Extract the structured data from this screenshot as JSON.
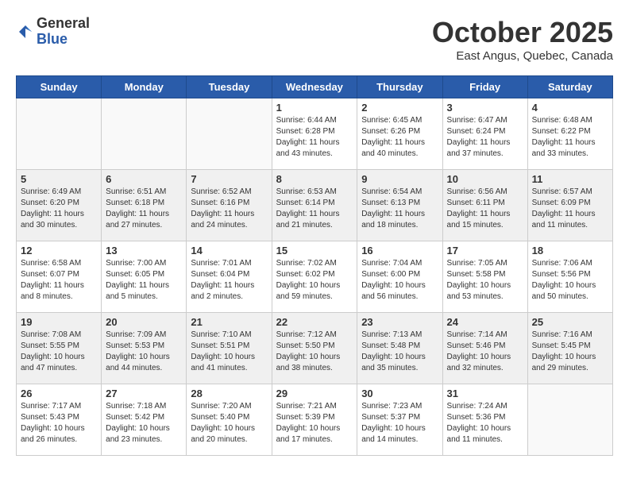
{
  "logo": {
    "general": "General",
    "blue": "Blue"
  },
  "title": "October 2025",
  "location": "East Angus, Quebec, Canada",
  "days_of_week": [
    "Sunday",
    "Monday",
    "Tuesday",
    "Wednesday",
    "Thursday",
    "Friday",
    "Saturday"
  ],
  "weeks": [
    [
      {
        "day": "",
        "info": ""
      },
      {
        "day": "",
        "info": ""
      },
      {
        "day": "",
        "info": ""
      },
      {
        "day": "1",
        "info": "Sunrise: 6:44 AM\nSunset: 6:28 PM\nDaylight: 11 hours\nand 43 minutes."
      },
      {
        "day": "2",
        "info": "Sunrise: 6:45 AM\nSunset: 6:26 PM\nDaylight: 11 hours\nand 40 minutes."
      },
      {
        "day": "3",
        "info": "Sunrise: 6:47 AM\nSunset: 6:24 PM\nDaylight: 11 hours\nand 37 minutes."
      },
      {
        "day": "4",
        "info": "Sunrise: 6:48 AM\nSunset: 6:22 PM\nDaylight: 11 hours\nand 33 minutes."
      }
    ],
    [
      {
        "day": "5",
        "info": "Sunrise: 6:49 AM\nSunset: 6:20 PM\nDaylight: 11 hours\nand 30 minutes."
      },
      {
        "day": "6",
        "info": "Sunrise: 6:51 AM\nSunset: 6:18 PM\nDaylight: 11 hours\nand 27 minutes."
      },
      {
        "day": "7",
        "info": "Sunrise: 6:52 AM\nSunset: 6:16 PM\nDaylight: 11 hours\nand 24 minutes."
      },
      {
        "day": "8",
        "info": "Sunrise: 6:53 AM\nSunset: 6:14 PM\nDaylight: 11 hours\nand 21 minutes."
      },
      {
        "day": "9",
        "info": "Sunrise: 6:54 AM\nSunset: 6:13 PM\nDaylight: 11 hours\nand 18 minutes."
      },
      {
        "day": "10",
        "info": "Sunrise: 6:56 AM\nSunset: 6:11 PM\nDaylight: 11 hours\nand 15 minutes."
      },
      {
        "day": "11",
        "info": "Sunrise: 6:57 AM\nSunset: 6:09 PM\nDaylight: 11 hours\nand 11 minutes."
      }
    ],
    [
      {
        "day": "12",
        "info": "Sunrise: 6:58 AM\nSunset: 6:07 PM\nDaylight: 11 hours\nand 8 minutes."
      },
      {
        "day": "13",
        "info": "Sunrise: 7:00 AM\nSunset: 6:05 PM\nDaylight: 11 hours\nand 5 minutes."
      },
      {
        "day": "14",
        "info": "Sunrise: 7:01 AM\nSunset: 6:04 PM\nDaylight: 11 hours\nand 2 minutes."
      },
      {
        "day": "15",
        "info": "Sunrise: 7:02 AM\nSunset: 6:02 PM\nDaylight: 10 hours\nand 59 minutes."
      },
      {
        "day": "16",
        "info": "Sunrise: 7:04 AM\nSunset: 6:00 PM\nDaylight: 10 hours\nand 56 minutes."
      },
      {
        "day": "17",
        "info": "Sunrise: 7:05 AM\nSunset: 5:58 PM\nDaylight: 10 hours\nand 53 minutes."
      },
      {
        "day": "18",
        "info": "Sunrise: 7:06 AM\nSunset: 5:56 PM\nDaylight: 10 hours\nand 50 minutes."
      }
    ],
    [
      {
        "day": "19",
        "info": "Sunrise: 7:08 AM\nSunset: 5:55 PM\nDaylight: 10 hours\nand 47 minutes."
      },
      {
        "day": "20",
        "info": "Sunrise: 7:09 AM\nSunset: 5:53 PM\nDaylight: 10 hours\nand 44 minutes."
      },
      {
        "day": "21",
        "info": "Sunrise: 7:10 AM\nSunset: 5:51 PM\nDaylight: 10 hours\nand 41 minutes."
      },
      {
        "day": "22",
        "info": "Sunrise: 7:12 AM\nSunset: 5:50 PM\nDaylight: 10 hours\nand 38 minutes."
      },
      {
        "day": "23",
        "info": "Sunrise: 7:13 AM\nSunset: 5:48 PM\nDaylight: 10 hours\nand 35 minutes."
      },
      {
        "day": "24",
        "info": "Sunrise: 7:14 AM\nSunset: 5:46 PM\nDaylight: 10 hours\nand 32 minutes."
      },
      {
        "day": "25",
        "info": "Sunrise: 7:16 AM\nSunset: 5:45 PM\nDaylight: 10 hours\nand 29 minutes."
      }
    ],
    [
      {
        "day": "26",
        "info": "Sunrise: 7:17 AM\nSunset: 5:43 PM\nDaylight: 10 hours\nand 26 minutes."
      },
      {
        "day": "27",
        "info": "Sunrise: 7:18 AM\nSunset: 5:42 PM\nDaylight: 10 hours\nand 23 minutes."
      },
      {
        "day": "28",
        "info": "Sunrise: 7:20 AM\nSunset: 5:40 PM\nDaylight: 10 hours\nand 20 minutes."
      },
      {
        "day": "29",
        "info": "Sunrise: 7:21 AM\nSunset: 5:39 PM\nDaylight: 10 hours\nand 17 minutes."
      },
      {
        "day": "30",
        "info": "Sunrise: 7:23 AM\nSunset: 5:37 PM\nDaylight: 10 hours\nand 14 minutes."
      },
      {
        "day": "31",
        "info": "Sunrise: 7:24 AM\nSunset: 5:36 PM\nDaylight: 10 hours\nand 11 minutes."
      },
      {
        "day": "",
        "info": ""
      }
    ]
  ],
  "row_shading": [
    false,
    true,
    false,
    true,
    false
  ]
}
